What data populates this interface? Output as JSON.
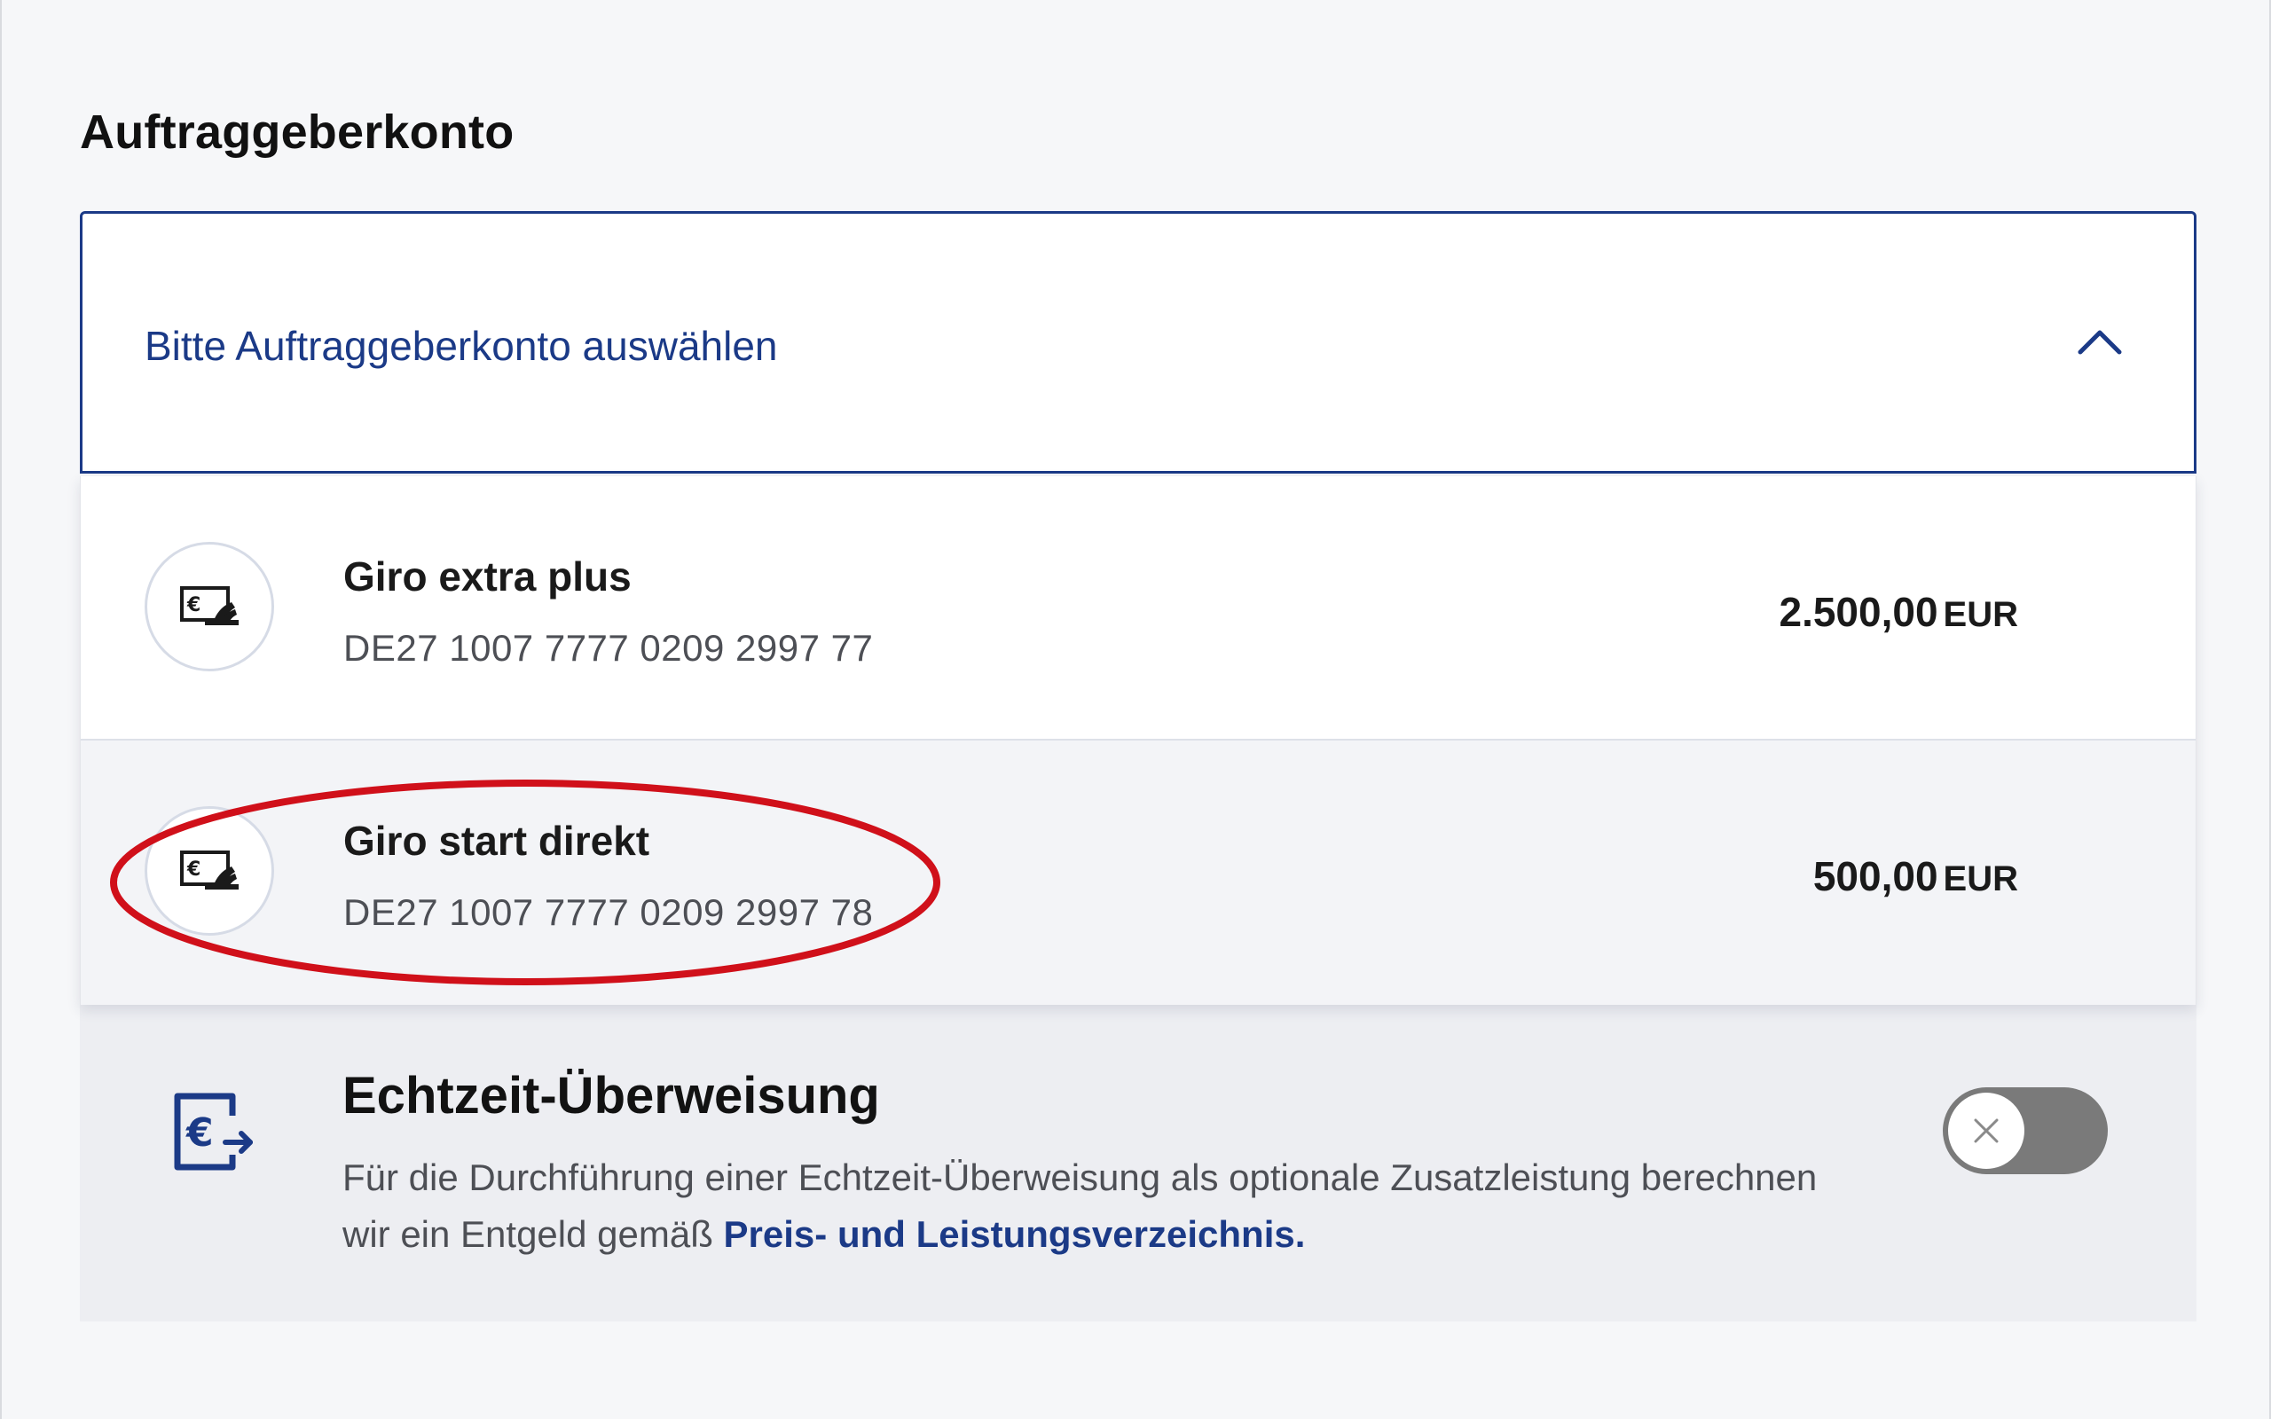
{
  "section": {
    "title": "Auftraggeberkonto"
  },
  "dropdown": {
    "placeholder": "Bitte Auftraggeberkonto auswählen",
    "expanded": true,
    "icon": "chevron-up-icon"
  },
  "accounts": [
    {
      "name": "Giro extra plus",
      "iban": "DE27 1007 7777 0209 2997 77",
      "amount": "2.500,00",
      "currency": "EUR",
      "icon": "wallet-euro-icon"
    },
    {
      "name": "Giro start direkt",
      "iban": "DE27 1007 7777 0209 2997 78",
      "amount": "500,00",
      "currency": "EUR",
      "icon": "wallet-euro-icon",
      "highlighted": true
    }
  ],
  "echtzeit": {
    "title": "Echtzeit-Überweisung",
    "description": "Für die Durchführung einer Echtzeit-Überweisung als optionale Zusatzleistung berechnen wir ein Entgeld gemäß",
    "link_text": "Preis- und Leistungsverzeichnis.",
    "toggle_on": false,
    "icon": "euro-transfer-icon"
  },
  "colors": {
    "brand": "#1b3a87",
    "highlight": "#d0101a",
    "background": "#f6f7f9",
    "card": "#edeef2"
  }
}
